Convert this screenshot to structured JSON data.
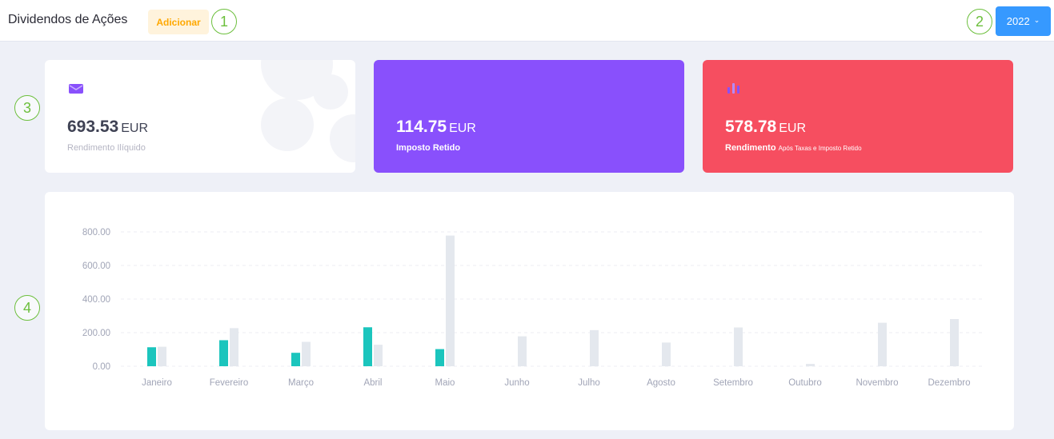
{
  "header": {
    "title": "Dividendos de Ações",
    "add_label": "Adicionar",
    "year_label": "2022"
  },
  "callouts": [
    "1",
    "2",
    "3",
    "4"
  ],
  "cards": [
    {
      "amount": "693.53",
      "unit": "EUR",
      "caption": "Rendimento Ilíquido",
      "icon": "envelope-icon"
    },
    {
      "amount": "114.75",
      "unit": "EUR",
      "caption": "Imposto Retido"
    },
    {
      "amount": "578.78",
      "unit": "EUR",
      "caption_main": "Rendimento",
      "caption_small": "Após Taxas e Imposto Retido",
      "icon": "bar-chart-icon"
    }
  ],
  "colors": {
    "accent_orange": "#ffa800",
    "year_button": "#3699ff",
    "card_purple": "#8950fc",
    "card_red": "#f64e60",
    "series_1": "#1bc5bd",
    "series_2": "#e4e8ee"
  },
  "chart_data": {
    "type": "bar",
    "categories": [
      "Janeiro",
      "Fevereiro",
      "Março",
      "Abril",
      "Maio",
      "Junho",
      "Julho",
      "Agosto",
      "Setembro",
      "Outubro",
      "Novembro",
      "Dezembro"
    ],
    "series": [
      {
        "values": [
          113,
          155,
          80,
          232,
          102,
          0,
          0,
          0,
          0,
          0,
          0,
          0
        ]
      },
      {
        "values": [
          116,
          227,
          145,
          128,
          778,
          178,
          215,
          141,
          231,
          14,
          259,
          281
        ]
      }
    ],
    "yticks": [
      "0.00",
      "200.00",
      "400.00",
      "600.00",
      "800.00"
    ],
    "ylim": [
      0,
      800
    ],
    "grid": true
  }
}
